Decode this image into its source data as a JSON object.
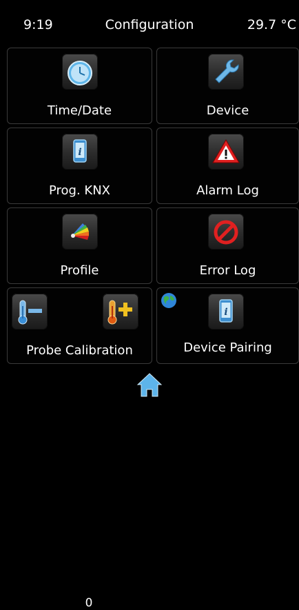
{
  "status_bar": {
    "time": "9:19",
    "title": "Configuration",
    "temperature": "29.7 °C"
  },
  "tiles": [
    {
      "label": "Time/Date",
      "icon": "clock-icon"
    },
    {
      "label": "Device",
      "icon": "wrench-icon"
    },
    {
      "label": "Prog. KNX",
      "icon": "phone-info-icon"
    },
    {
      "label": "Alarm Log",
      "icon": "warning-triangle-icon"
    },
    {
      "label": "Profile",
      "icon": "color-palette-icon"
    },
    {
      "label": "Error Log",
      "icon": "prohibited-icon"
    },
    {
      "label": "Probe Calibration",
      "icon": "thermometer-icon",
      "value": "0"
    },
    {
      "label": "Device Pairing",
      "icon": "phone-info-icon"
    }
  ],
  "colors": {
    "accent_blue": "#4aa8e0",
    "warning_red": "#e02020",
    "border": "#3a3a3a"
  },
  "nav": {
    "home_icon": "home-icon"
  }
}
